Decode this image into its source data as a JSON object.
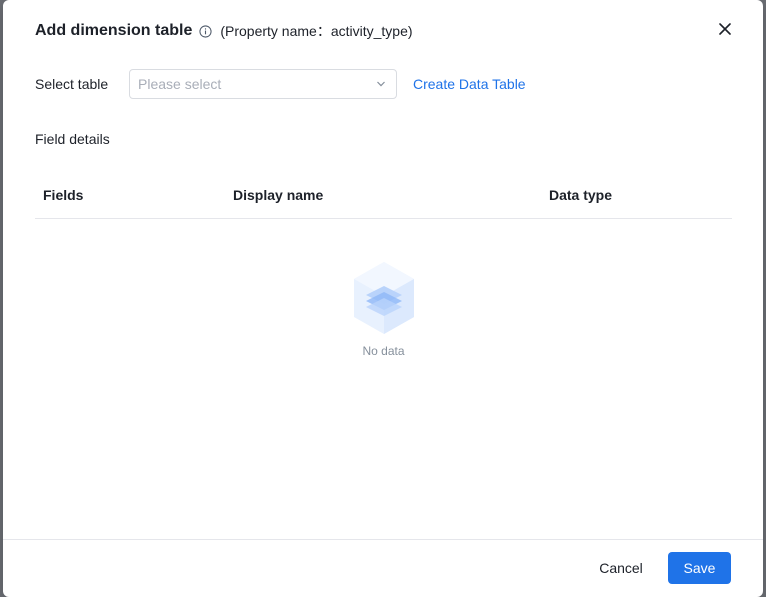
{
  "dialog": {
    "title": "Add dimension table",
    "subtitle": "(Property name：activity_type)",
    "info_icon": "info-circle-icon",
    "close_icon": "close-icon"
  },
  "select_table": {
    "label": "Select table",
    "placeholder": "Please select",
    "create_link": "Create Data Table"
  },
  "field_details": {
    "heading": "Field details",
    "columns": [
      "Fields",
      "Display name",
      "Data type"
    ],
    "rows": [],
    "empty_text": "No data"
  },
  "footer": {
    "cancel_label": "Cancel",
    "save_label": "Save"
  },
  "colors": {
    "accent": "#1f73e8",
    "border": "#e5e6eb",
    "placeholder": "#a9aeb8"
  }
}
